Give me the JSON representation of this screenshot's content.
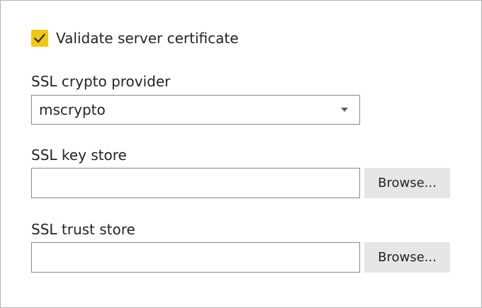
{
  "validate_certificate": {
    "label": "Validate server certificate",
    "checked": true,
    "icon": "checkmark-icon",
    "accent_color": "#f2c811"
  },
  "crypto_provider": {
    "label": "SSL crypto provider",
    "value": "mscrypto",
    "icon": "chevron-down-icon"
  },
  "key_store": {
    "label": "SSL key store",
    "value": "",
    "browse_label": "Browse..."
  },
  "trust_store": {
    "label": "SSL trust store",
    "value": "",
    "browse_label": "Browse..."
  }
}
